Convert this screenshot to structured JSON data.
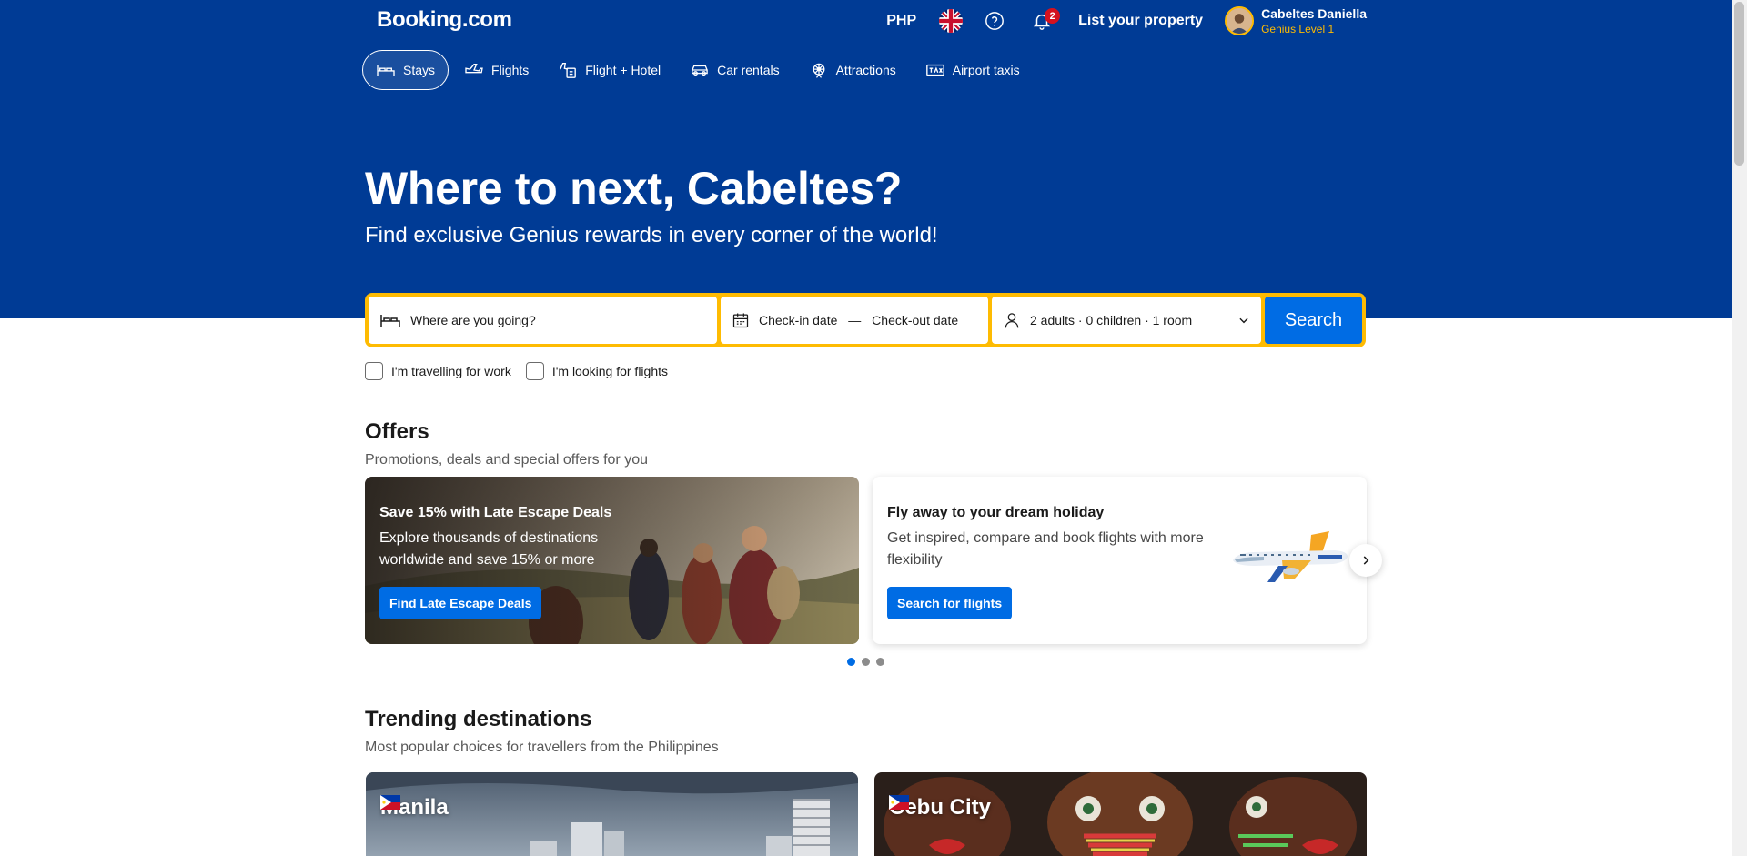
{
  "header": {
    "logo": "Booking.com",
    "currency": "PHP",
    "notification_count": "2",
    "list_property": "List your property",
    "user_name": "Cabeltes Daniella",
    "user_level": "Genius Level 1"
  },
  "nav": {
    "tabs": [
      {
        "label": "Stays",
        "icon": "bed-icon",
        "active": true
      },
      {
        "label": "Flights",
        "icon": "plane-icon"
      },
      {
        "label": "Flight + Hotel",
        "icon": "flight-hotel-icon"
      },
      {
        "label": "Car rentals",
        "icon": "car-icon"
      },
      {
        "label": "Attractions",
        "icon": "attractions-icon"
      },
      {
        "label": "Airport taxis",
        "icon": "taxi-icon"
      }
    ]
  },
  "hero": {
    "title": "Where to next, Cabeltes?",
    "subtitle": "Find exclusive Genius rewards in every corner of the world!"
  },
  "search": {
    "destination_placeholder": "Where are you going?",
    "checkin": "Check-in date",
    "dash": "—",
    "checkout": "Check-out date",
    "guests": "2 adults · 0 children · 1 room",
    "button": "Search",
    "work_checkbox": "I'm travelling for work",
    "flights_checkbox": "I'm looking for flights"
  },
  "offers": {
    "title": "Offers",
    "subtitle": "Promotions, deals and special offers for you",
    "cards": [
      {
        "heading": "Save 15% with Late Escape Deals",
        "body": "Explore thousands of destinations worldwide and save 15% or more",
        "button": "Find Late Escape Deals"
      },
      {
        "heading": "Fly away to your dream holiday",
        "body": "Get inspired, compare and book flights with more flexibility",
        "button": "Search for flights"
      }
    ]
  },
  "trending": {
    "title": "Trending destinations",
    "subtitle": "Most popular choices for travellers from the Philippines",
    "destinations": [
      {
        "name": "Manila"
      },
      {
        "name": "Cebu City"
      }
    ]
  },
  "colors": {
    "brand_blue": "#003b95",
    "action_blue": "#006ce4",
    "genius_yellow": "#febb02"
  }
}
